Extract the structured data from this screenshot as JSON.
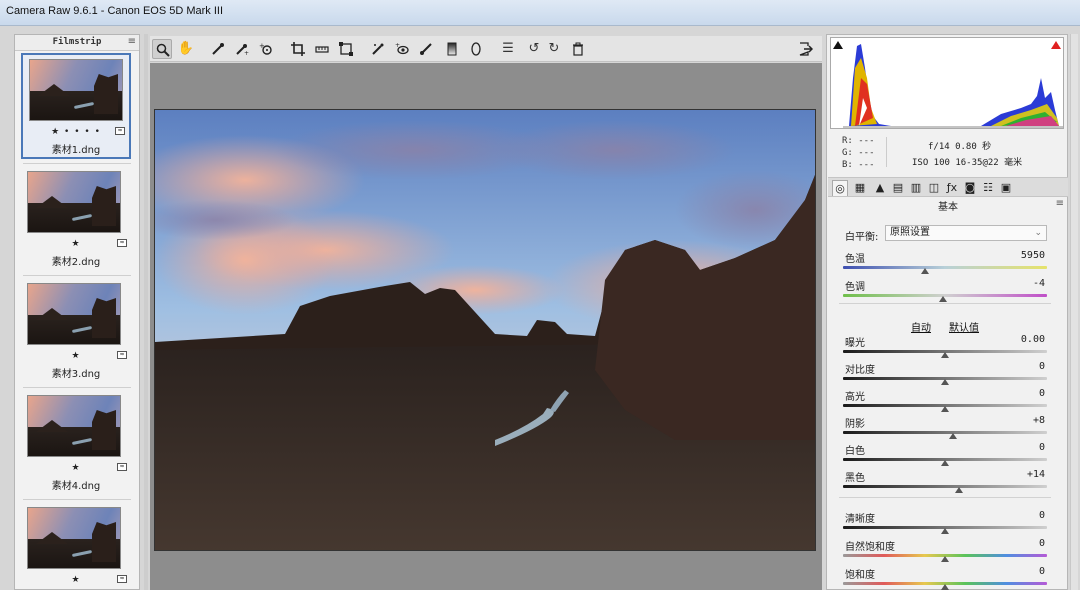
{
  "window": {
    "title": "Camera Raw 9.6.1 -  Canon EOS 5D Mark III"
  },
  "filmstrip": {
    "title": "Filmstrip",
    "items": [
      {
        "name": "素材1.dng",
        "rating": "★ • • • •",
        "selected": true
      },
      {
        "name": "素材2.dng",
        "rating": "★"
      },
      {
        "name": "素材3.dng",
        "rating": "★"
      },
      {
        "name": "素材4.dng",
        "rating": "★"
      },
      {
        "name": "",
        "rating": "★"
      }
    ]
  },
  "toolbar": {
    "tools": [
      "zoom-icon",
      "hand-icon",
      "white-balance-icon",
      "color-sampler-icon",
      "targeted-adjustment-icon",
      "crop-icon",
      "straighten-icon",
      "transform-icon",
      "spot-removal-icon",
      "red-eye-icon",
      "adjustment-brush-icon",
      "graduated-filter-icon",
      "radial-filter-icon",
      "preferences-icon",
      "rotate-ccw-icon",
      "rotate-cw-icon",
      "trash-icon"
    ],
    "toggle": "fullscreen-icon"
  },
  "readout": {
    "r": "R:  ---",
    "g": "G:  ---",
    "b": "B:  ---",
    "exif_line1": "f/14   0.80 秒",
    "exif_line2": "ISO 100   16-35@22 毫米"
  },
  "panel": {
    "title": "基本",
    "white_balance_label": "白平衡:",
    "white_balance_value": "原照设置",
    "auto_label": "自动",
    "default_label": "默认值",
    "sliders": [
      {
        "label": "色温",
        "value": "5950",
        "level": 0.4
      },
      {
        "label": "色调",
        "value": "-4",
        "level": 0.49
      },
      {
        "label": "曝光",
        "value": "0.00",
        "level": 0.5
      },
      {
        "label": "对比度",
        "value": "0",
        "level": 0.5
      },
      {
        "label": "高光",
        "value": "0",
        "level": 0.5
      },
      {
        "label": "阴影",
        "value": "+8",
        "level": 0.54
      },
      {
        "label": "白色",
        "value": "0",
        "level": 0.5
      },
      {
        "label": "黑色",
        "value": "+14",
        "level": 0.57
      },
      {
        "label": "清晰度",
        "value": "0",
        "level": 0.5
      },
      {
        "label": "自然饱和度",
        "value": "0",
        "level": 0.5
      },
      {
        "label": "饱和度",
        "value": "0",
        "level": 0.5
      }
    ]
  },
  "colors": {
    "selection": "#4a78b8",
    "highlight_clip": "#e02020",
    "shadow_clip": "#111111"
  }
}
